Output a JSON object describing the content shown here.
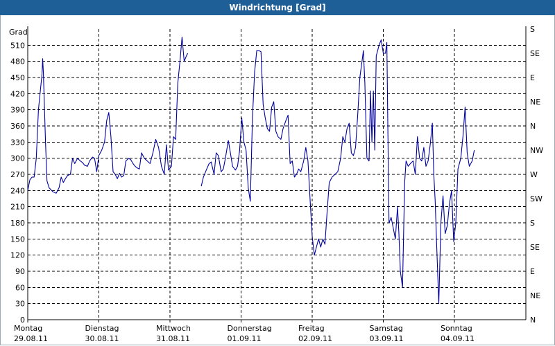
{
  "window": {
    "title": "Windrichtung [Grad]"
  },
  "chart_data": {
    "type": "line",
    "title": "Windrichtung [Grad]",
    "ylabel": "Grad",
    "ylim": [
      0,
      540
    ],
    "yticks": [
      0,
      30,
      60,
      90,
      120,
      150,
      180,
      210,
      240,
      270,
      300,
      330,
      360,
      390,
      420,
      450,
      480,
      510
    ],
    "right_axis_labels": [
      "N",
      "NE",
      "E",
      "SE",
      "S",
      "SW",
      "W",
      "NW",
      "N",
      "NE",
      "E",
      "SE",
      "S"
    ],
    "right_axis_values": [
      0,
      45,
      90,
      135,
      180,
      225,
      270,
      315,
      360,
      405,
      450,
      495,
      540
    ],
    "xlim": [
      0,
      7
    ],
    "x_categories": [
      {
        "day": "Montag",
        "date": "29.08.11"
      },
      {
        "day": "Dienstag",
        "date": "30.08.11"
      },
      {
        "day": "Mittwoch",
        "date": "31.08.11"
      },
      {
        "day": "Donnerstag",
        "date": "01.09.11"
      },
      {
        "day": "Freitag",
        "date": "02.09.11"
      },
      {
        "day": "Samstag",
        "date": "03.09.11"
      },
      {
        "day": "Sonntag",
        "date": "04.09.11"
      }
    ],
    "grid": true,
    "line_color": "#0000a0",
    "series": [
      {
        "segments": [
          [
            [
              0.0,
              240
            ],
            [
              0.03,
              260
            ],
            [
              0.06,
              265
            ],
            [
              0.09,
              265
            ],
            [
              0.12,
              300
            ],
            [
              0.15,
              390
            ],
            [
              0.18,
              430
            ],
            [
              0.2,
              455
            ],
            [
              0.21,
              485
            ],
            [
              0.22,
              460
            ],
            [
              0.25,
              330
            ],
            [
              0.27,
              258
            ],
            [
              0.3,
              245
            ],
            [
              0.35,
              238
            ],
            [
              0.4,
              235
            ],
            [
              0.44,
              245
            ],
            [
              0.47,
              265
            ],
            [
              0.5,
              255
            ],
            [
              0.53,
              262
            ],
            [
              0.56,
              268
            ],
            [
              0.6,
              270
            ],
            [
              0.63,
              300
            ],
            [
              0.66,
              290
            ],
            [
              0.7,
              300
            ],
            [
              0.74,
              295
            ],
            [
              0.77,
              292
            ],
            [
              0.8,
              287
            ],
            [
              0.84,
              285
            ],
            [
              0.87,
              295
            ],
            [
              0.91,
              302
            ],
            [
              0.94,
              300
            ],
            [
              0.97,
              275
            ],
            [
              1.0,
              305
            ],
            [
              1.04,
              315
            ],
            [
              1.08,
              330
            ],
            [
              1.11,
              370
            ],
            [
              1.14,
              385
            ],
            [
              1.17,
              340
            ],
            [
              1.2,
              275
            ],
            [
              1.23,
              270
            ],
            [
              1.26,
              262
            ],
            [
              1.29,
              272
            ],
            [
              1.32,
              265
            ],
            [
              1.35,
              268
            ],
            [
              1.38,
              295
            ],
            [
              1.42,
              300
            ],
            [
              1.45,
              297
            ],
            [
              1.48,
              290
            ],
            [
              1.51,
              285
            ],
            [
              1.54,
              282
            ],
            [
              1.57,
              280
            ],
            [
              1.6,
              310
            ],
            [
              1.64,
              300
            ],
            [
              1.68,
              295
            ],
            [
              1.72,
              290
            ],
            [
              1.76,
              310
            ],
            [
              1.8,
              335
            ],
            [
              1.84,
              320
            ],
            [
              1.88,
              285
            ],
            [
              1.92,
              270
            ],
            [
              1.95,
              325
            ],
            [
              1.98,
              278
            ],
            [
              2.02,
              285
            ],
            [
              2.05,
              340
            ],
            [
              2.08,
              335
            ],
            [
              2.11,
              440
            ],
            [
              2.14,
              480
            ],
            [
              2.17,
              525
            ],
            [
              2.2,
              480
            ],
            [
              2.23,
              490
            ],
            [
              2.25,
              495
            ]
          ],
          [
            [
              2.44,
              248
            ],
            [
              2.47,
              265
            ],
            [
              2.51,
              278
            ],
            [
              2.55,
              290
            ],
            [
              2.58,
              293
            ],
            [
              2.62,
              270
            ],
            [
              2.65,
              310
            ],
            [
              2.68,
              305
            ],
            [
              2.72,
              275
            ],
            [
              2.75,
              280
            ],
            [
              2.78,
              300
            ],
            [
              2.82,
              333
            ],
            [
              2.85,
              310
            ],
            [
              2.88,
              285
            ],
            [
              2.92,
              278
            ],
            [
              2.95,
              285
            ],
            [
              2.98,
              315
            ],
            [
              3.01,
              375
            ],
            [
              3.04,
              330
            ],
            [
              3.07,
              315
            ],
            [
              3.1,
              245
            ],
            [
              3.13,
              220
            ],
            [
              3.16,
              375
            ],
            [
              3.19,
              460
            ],
            [
              3.22,
              500
            ],
            [
              3.25,
              500
            ],
            [
              3.28,
              498
            ],
            [
              3.31,
              400
            ],
            [
              3.34,
              375
            ],
            [
              3.37,
              355
            ],
            [
              3.4,
              350
            ],
            [
              3.43,
              395
            ],
            [
              3.46,
              405
            ],
            [
              3.49,
              350
            ],
            [
              3.52,
              340
            ],
            [
              3.56,
              335
            ],
            [
              3.59,
              355
            ],
            [
              3.63,
              370
            ],
            [
              3.66,
              380
            ],
            [
              3.69,
              290
            ],
            [
              3.72,
              295
            ],
            [
              3.75,
              265
            ],
            [
              3.78,
              270
            ],
            [
              3.81,
              280
            ],
            [
              3.84,
              275
            ],
            [
              3.88,
              295
            ],
            [
              3.91,
              320
            ],
            [
              3.94,
              295
            ],
            [
              3.97,
              225
            ],
            [
              4.0,
              155
            ],
            [
              4.03,
              120
            ],
            [
              4.06,
              135
            ],
            [
              4.09,
              150
            ],
            [
              4.12,
              135
            ],
            [
              4.15,
              150
            ],
            [
              4.18,
              140
            ],
            [
              4.21,
              200
            ],
            [
              4.24,
              255
            ],
            [
              4.28,
              265
            ],
            [
              4.32,
              270
            ],
            [
              4.36,
              275
            ],
            [
              4.4,
              300
            ],
            [
              4.43,
              340
            ],
            [
              4.46,
              330
            ],
            [
              4.49,
              355
            ],
            [
              4.52,
              365
            ],
            [
              4.55,
              310
            ],
            [
              4.58,
              305
            ],
            [
              4.61,
              320
            ],
            [
              4.64,
              380
            ],
            [
              4.67,
              450
            ],
            [
              4.7,
              480
            ],
            [
              4.72,
              500
            ],
            [
              4.74,
              440
            ],
            [
              4.77,
              300
            ],
            [
              4.8,
              295
            ],
            [
              4.82,
              425
            ],
            [
              4.84,
              330
            ],
            [
              4.86,
              425
            ],
            [
              4.88,
              315
            ],
            [
              4.9,
              490
            ],
            [
              4.94,
              510
            ],
            [
              4.97,
              520
            ],
            [
              5.0,
              495
            ],
            [
              5.03,
              495
            ],
            [
              5.05,
              515
            ],
            [
              5.08,
              180
            ],
            [
              5.11,
              190
            ],
            [
              5.14,
              170
            ],
            [
              5.17,
              150
            ],
            [
              5.2,
              210
            ],
            [
              5.22,
              160
            ],
            [
              5.24,
              90
            ],
            [
              5.27,
              60
            ],
            [
              5.3,
              255
            ],
            [
              5.32,
              295
            ],
            [
              5.35,
              285
            ],
            [
              5.38,
              290
            ],
            [
              5.42,
              295
            ],
            [
              5.45,
              270
            ],
            [
              5.48,
              340
            ],
            [
              5.51,
              300
            ],
            [
              5.54,
              295
            ],
            [
              5.57,
              320
            ],
            [
              5.6,
              285
            ],
            [
              5.63,
              295
            ],
            [
              5.66,
              325
            ],
            [
              5.69,
              365
            ],
            [
              5.71,
              270
            ],
            [
              5.73,
              220
            ],
            [
              5.75,
              140
            ],
            [
              5.78,
              30
            ],
            [
              5.81,
              180
            ],
            [
              5.84,
              230
            ],
            [
              5.87,
              160
            ],
            [
              5.9,
              175
            ],
            [
              5.93,
              215
            ],
            [
              5.96,
              240
            ],
            [
              5.99,
              145
            ],
            [
              6.02,
              180
            ],
            [
              6.05,
              280
            ],
            [
              6.09,
              300
            ],
            [
              6.12,
              340
            ],
            [
              6.15,
              395
            ],
            [
              6.18,
              310
            ],
            [
              6.21,
              285
            ],
            [
              6.25,
              295
            ],
            [
              6.28,
              315
            ]
          ]
        ]
      }
    ]
  }
}
